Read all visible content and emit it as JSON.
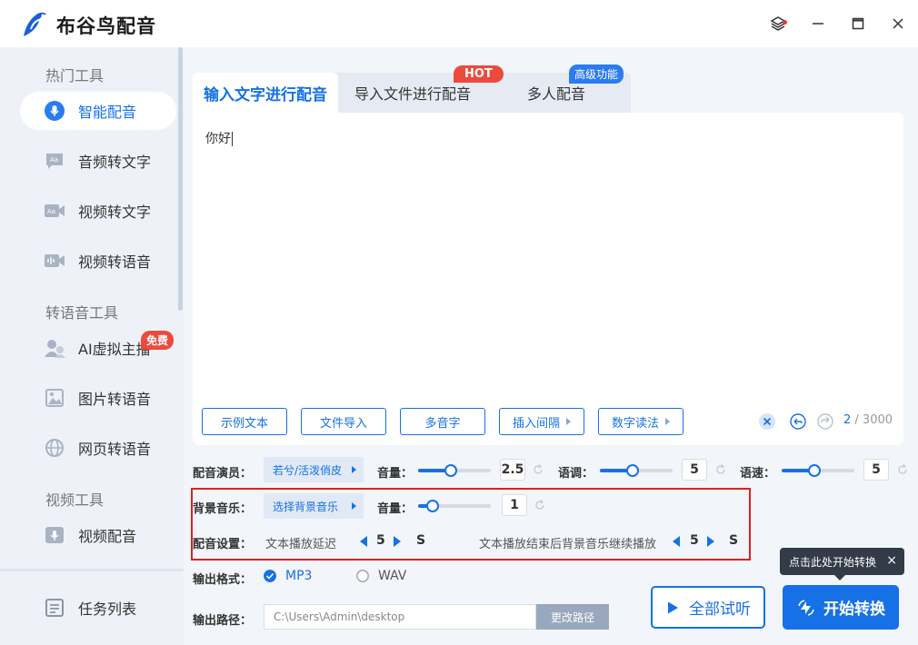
{
  "app": {
    "title": "布谷鸟配音",
    "icons": {
      "layers": "layers-icon",
      "minimize": "minimize-icon",
      "maximize": "maximize-icon",
      "close": "close-icon"
    }
  },
  "sidebar": {
    "groups": {
      "hot": "热门工具",
      "tts": "转语音工具",
      "video": "视频工具"
    },
    "items": [
      {
        "label": "智能配音",
        "icon": "microphone-icon",
        "active": true
      },
      {
        "label": "音频转文字",
        "icon": "audio-text-icon"
      },
      {
        "label": "视频转文字",
        "icon": "video-text-icon"
      },
      {
        "label": "视频转语音",
        "icon": "video-voice-icon"
      },
      {
        "label": "AI虚拟主播",
        "icon": "avatar-icon",
        "badge": "免费"
      },
      {
        "label": "图片转语音",
        "icon": "image-icon"
      },
      {
        "label": "网页转语音",
        "icon": "globe-icon"
      },
      {
        "label": "视频配音",
        "icon": "video-mic-icon"
      },
      {
        "label": "任务列表",
        "icon": "task-list-icon"
      }
    ]
  },
  "tabs": [
    {
      "label": "输入文字进行配音",
      "active": true
    },
    {
      "label": "导入文件进行配音",
      "badge": "HOT"
    },
    {
      "label": "多人配音",
      "badge": "高级功能"
    }
  ],
  "editor": {
    "text": "你好",
    "buttons": [
      "示例文本",
      "文件导入",
      "多音字",
      "插入间隔",
      "数字读法"
    ],
    "count": "2",
    "max": " / 3000"
  },
  "voice": {
    "label": "配音演员：",
    "selected": "若兮/活泼俏皮",
    "volume_label": "音量：",
    "volume": 2.5,
    "volume_fraction": 0.45,
    "pitch_label": "语调：",
    "pitch": 5,
    "pitch_fraction": 0.45,
    "speed_label": "语速：",
    "speed": 5,
    "speed_fraction": 0.45
  },
  "bgm": {
    "label": "背景音乐：",
    "selected": "选择背景音乐",
    "volume_label": "音量：",
    "volume": 1,
    "volume_fraction": 0.2
  },
  "dub_settings": {
    "label": "配音设置：",
    "delay_label": "文本播放延迟",
    "delay_value": 5,
    "delay_unit": "S",
    "continue_label": "文本播放结束后背景音乐继续播放",
    "continue_value": 5,
    "continue_unit": "S"
  },
  "output": {
    "format_label": "输出格式：",
    "formats": [
      {
        "label": "MP3",
        "checked": true
      },
      {
        "label": "WAV",
        "checked": false
      }
    ],
    "path_label": "输出路径：",
    "path": "C:\\Users\\Admin\\desktop",
    "change_path": "更改路径"
  },
  "actions": {
    "listen": "全部试听",
    "start": "开始转换",
    "tooltip": "点击此处开始转换",
    "tooltip_close": "×"
  },
  "colors": {
    "accent": "#1671e6",
    "badge_red": "#ec4a3c",
    "highlight": "#e02020"
  }
}
